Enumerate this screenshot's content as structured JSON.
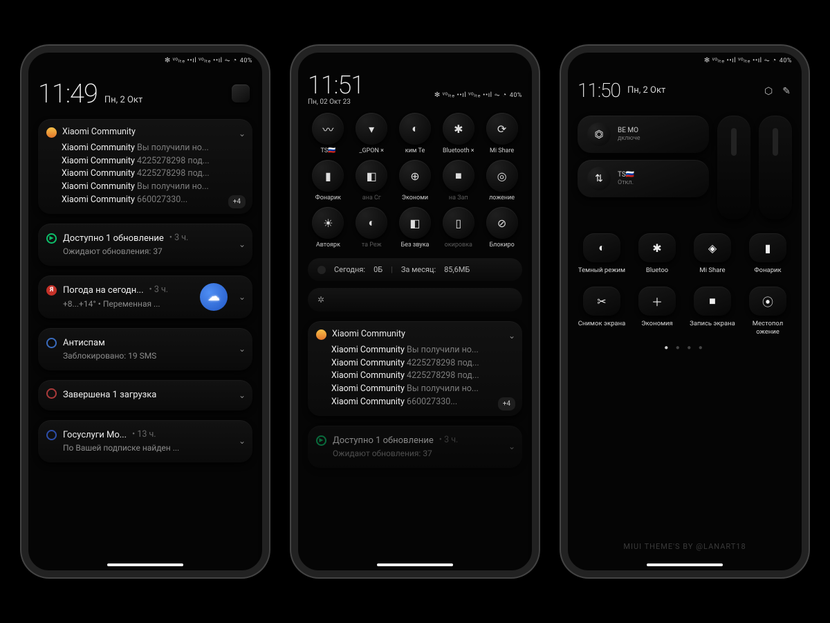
{
  "status": {
    "icons": "✻ ᵛᵒₗₜₑ ••ıl ᵛᵒₗₜₑ ••ıl ⏦ ◔",
    "battery": "40%"
  },
  "phone1": {
    "time": "11:49",
    "date": "Пн, 2 Окт",
    "notif1": {
      "app": "Xiaomi Community",
      "lines": [
        {
          "b": "Xiaomi Community",
          "g": " Вы получили но..."
        },
        {
          "b": "Xiaomi Community",
          "g": " 4225278298 под..."
        },
        {
          "b": "Xiaomi Community",
          "g": " 4225278298 под..."
        },
        {
          "b": "Xiaomi Community",
          "g": " Вы получили но..."
        },
        {
          "b": "Xiaomi Community",
          "g": " 660027330..."
        }
      ],
      "more": "+4"
    },
    "notif2": {
      "title": "Доступно 1 обновление",
      "time": "• 3 ч.",
      "sub": "Ожидают обновления: 37"
    },
    "notif3": {
      "title": "Погода на сегодн...",
      "time": "• 3 ч.",
      "sub": "+8...+14° • Переменная ..."
    },
    "notif4": {
      "title": "Антиспам",
      "sub": "Заблокировано: 19 SMS"
    },
    "notif5": {
      "title": "Завершена 1 загрузка"
    },
    "notif6": {
      "title": "Госуслуги Мо...",
      "time": "• 13 ч.",
      "sub": "По Вашей подписке найден ..."
    }
  },
  "phone2": {
    "time": "11:51",
    "date": "Пн, 02 Окт 23",
    "row1": [
      {
        "lbl": "TS🇷🇺",
        "ico": "〰"
      },
      {
        "lbl": "_GPON ×",
        "ico": "▾"
      },
      {
        "lbl": "ким   Те",
        "ico": "◐"
      },
      {
        "lbl": "Bluetooth ×",
        "ico": "✱"
      },
      {
        "lbl": "Mi Share",
        "ico": "⟳"
      }
    ],
    "row2": [
      {
        "lbl": "Фонарик",
        "ico": "▮"
      },
      {
        "lbl": "ана    Сг",
        "ico": "◧",
        "dim": true
      },
      {
        "lbl": "Экономи",
        "ico": "⊕"
      },
      {
        "lbl": "на    Зап",
        "ico": "■",
        "dim": true
      },
      {
        "lbl": "ложение",
        "ico": "◎"
      }
    ],
    "row3": [
      {
        "lbl": "Автоярк",
        "ico": "☀"
      },
      {
        "lbl": "та      Реж",
        "ico": "◐",
        "dim": true
      },
      {
        "lbl": "Без звука",
        "ico": "◧"
      },
      {
        "lbl": "окировка",
        "ico": "▯",
        "dim": true
      },
      {
        "lbl": "Блокиро",
        "ico": "⊘"
      }
    ],
    "net": {
      "today_lbl": "Сегодня:",
      "today_val": "0Б",
      "month_lbl": "За месяц:",
      "month_val": "85,6МБ"
    },
    "notif": {
      "app": "Xiaomi Community",
      "lines": [
        {
          "b": "Xiaomi Community",
          "g": " Вы получили но..."
        },
        {
          "b": "Xiaomi Community",
          "g": " 4225278298 под..."
        },
        {
          "b": "Xiaomi Community",
          "g": " 4225278298 под..."
        },
        {
          "b": "Xiaomi Community",
          "g": " Вы получили но..."
        },
        {
          "b": "Xiaomi Community",
          "g": " 660027330..."
        }
      ],
      "more": "+4"
    },
    "notif2": {
      "title": "Доступно 1 обновление",
      "time": "• 3 ч.",
      "sub": "Ожидают обновления: 37"
    }
  },
  "phone3": {
    "time": "11:50",
    "date": "Пн, 2 Окт",
    "wifi": {
      "title": "BE   MO",
      "sub": "дключе"
    },
    "sim": {
      "title": "TS🇷🇺",
      "sub": "Откл."
    },
    "tiles": [
      {
        "lbl": "Темный режим",
        "ico": "◐"
      },
      {
        "lbl": "Bluetoo",
        "ico": "✱"
      },
      {
        "lbl": "Mi Share",
        "ico": "◈"
      },
      {
        "lbl": "Фонарик",
        "ico": "▮"
      },
      {
        "lbl": "Снимок экрана",
        "ico": "✂"
      },
      {
        "lbl": "Экономия",
        "ico": "＋"
      },
      {
        "lbl": "Запись экрана",
        "ico": "■"
      },
      {
        "lbl": "Местопол ожение",
        "ico": "⦿"
      }
    ],
    "credit": "MIUI THEME'S BY @LANART18"
  }
}
